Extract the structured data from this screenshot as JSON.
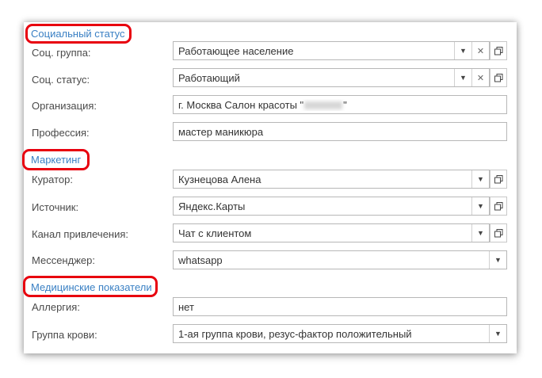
{
  "sections": {
    "social": "Социальный статус",
    "marketing": "Маркетинг",
    "medical": "Медицинские показатели"
  },
  "fields": {
    "soc_group": {
      "label": "Соц. группа:",
      "value": "Работающее население"
    },
    "soc_status": {
      "label": "Соц. статус:",
      "value": "Работающий"
    },
    "organization": {
      "label": "Организация:",
      "value_prefix": "г. Москва Салон красоты \"",
      "value_suffix": "\""
    },
    "profession": {
      "label": "Профессия:",
      "value": "мастер маникюра"
    },
    "curator": {
      "label": "Куратор:",
      "value": "Кузнецова Алена"
    },
    "source": {
      "label": "Источник:",
      "value": "Яндекс.Карты"
    },
    "channel": {
      "label": "Канал привлечения:",
      "value": "Чат с клиентом"
    },
    "messenger": {
      "label": "Мессенджер:",
      "value": "whatsapp"
    },
    "allergy": {
      "label": "Аллергия:",
      "value": "нет"
    },
    "blood_group": {
      "label": "Группа крови:",
      "value": "1-ая группа крови, резус-фактор положительный"
    }
  },
  "icons": {
    "dropdown": "chevron-down-icon",
    "clear": "close-icon",
    "open": "open-form-icon"
  },
  "colors": {
    "section_title": "#3a80c4",
    "highlight": "#e8000e",
    "border": "#b7b7b7"
  }
}
